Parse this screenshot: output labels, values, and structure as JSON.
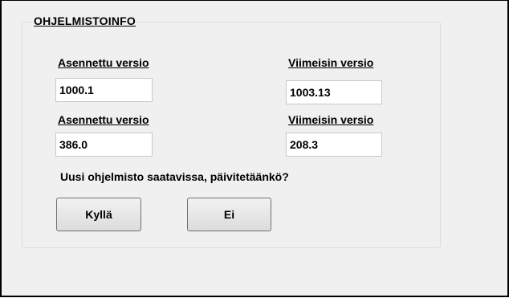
{
  "group": {
    "title": "OHJELMISTOINFO"
  },
  "rows": [
    {
      "installed_label": "Asennettu versio",
      "installed_value": "1000.1",
      "latest_label": "Viimeisin versio",
      "latest_value": "1003.13"
    },
    {
      "installed_label": "Asennettu versio",
      "installed_value": "386.0",
      "latest_label": "Viimeisin versio",
      "latest_value": "208.3"
    }
  ],
  "message": "Uusi ohjelmisto saatavissa, päivitetäänkö?",
  "buttons": {
    "yes": "Kyllä",
    "no": "Ei"
  }
}
